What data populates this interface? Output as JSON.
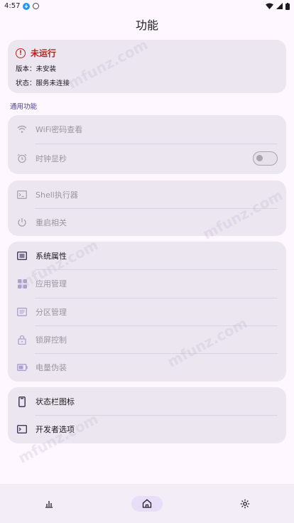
{
  "status_bar": {
    "time": "4:57"
  },
  "title": "功能",
  "status_card": {
    "state": "未运行",
    "version_line": "版本：未安装",
    "state_line": "状态：服务未连接"
  },
  "section_general": "通用功能",
  "group1": [
    {
      "label": "WiFi密码查看"
    },
    {
      "label": "时钟显秒",
      "toggle": false
    }
  ],
  "group2": [
    {
      "label": "Shell执行器"
    },
    {
      "label": "重启相关"
    }
  ],
  "group3": [
    {
      "label": "系统属性"
    },
    {
      "label": "应用管理"
    },
    {
      "label": "分区管理"
    },
    {
      "label": "锁屏控制"
    },
    {
      "label": "电量伪装"
    }
  ],
  "group4": [
    {
      "label": "状态栏图标"
    },
    {
      "label": "开发者选项"
    }
  ],
  "watermark": "mfunz.com",
  "nav": [
    "stats-icon",
    "home-icon",
    "settings-icon"
  ],
  "colors": {
    "accent": "#4a3f8f",
    "error": "#b3261e",
    "surface": "#ece6f0"
  }
}
